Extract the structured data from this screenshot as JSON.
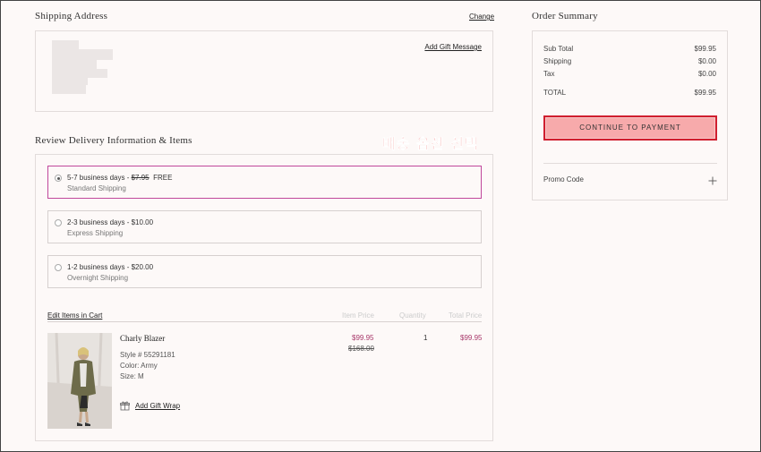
{
  "shipping_address": {
    "title": "Shipping Address",
    "change_link": "Change",
    "gift_message_link": "Add Gift Message"
  },
  "delivery": {
    "title": "Review Delivery Information & Items",
    "annotation": "배송 옵션 선택",
    "options": [
      {
        "days": "5-7 business days - ",
        "old_price": "$7.95",
        "price": "FREE",
        "method": "Standard Shipping",
        "selected": true
      },
      {
        "days": "2-3 business days - $10.00",
        "old_price": "",
        "price": "",
        "method": "Express Shipping",
        "selected": false
      },
      {
        "days": "1-2 business days - $20.00",
        "old_price": "",
        "price": "",
        "method": "Overnight Shipping",
        "selected": false
      }
    ]
  },
  "cart": {
    "edit_link": "Edit Items in Cart",
    "headers": {
      "item_price": "Item Price",
      "quantity": "Quantity",
      "total_price": "Total Price"
    },
    "item": {
      "name": "Charly Blazer",
      "style": "Style # 55291181",
      "color": "Color: Army",
      "size": "Size: M",
      "price": "$99.95",
      "original_price": "$168.00",
      "quantity": "1",
      "total": "$99.95",
      "gift_wrap_link": "Add Gift Wrap"
    }
  },
  "order_summary": {
    "title": "Order Summary",
    "rows": [
      {
        "label": "Sub Total",
        "value": "$99.95"
      },
      {
        "label": "Shipping",
        "value": "$0.00"
      },
      {
        "label": "Tax",
        "value": "$0.00"
      },
      {
        "label": "TOTAL",
        "value": "$99.95"
      }
    ],
    "continue_button": "CONTINUE TO PAYMENT",
    "promo_label": "Promo Code"
  },
  "colors": {
    "accent_pink": "#c0479b",
    "sale_price": "#a8386a",
    "button_fill": "#f7aaab",
    "button_border": "#d01f2f",
    "annotation_red": "#e8322f"
  }
}
